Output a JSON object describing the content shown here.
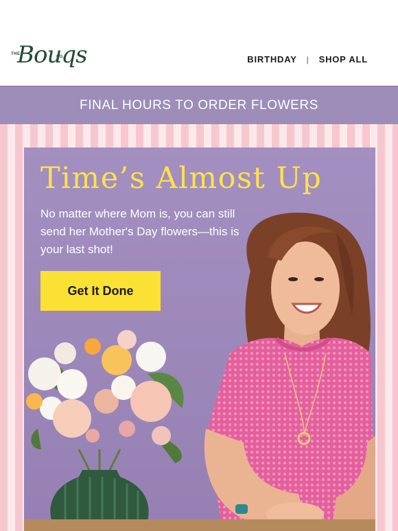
{
  "brand": {
    "logo_the": "THE",
    "logo_script": "Bouqs",
    "logo_co": "CO."
  },
  "nav": {
    "items": [
      {
        "label": "BIRTHDAY"
      },
      {
        "label": "SHOP ALL"
      }
    ],
    "separator": "|"
  },
  "banner": {
    "text": "FINAL HOURS TO ORDER FLOWERS",
    "color": "#9d8db8"
  },
  "hero": {
    "headline": "Time’s Almost Up",
    "body": "No matter where Mom is, you can still send her Mother's Day flowers—this is your last shot!",
    "cta_label": "Get It Done",
    "headline_color": "#fce24a",
    "cta_color": "#fbe134",
    "background_color": "#9c87b9"
  },
  "icons": {
    "logo": "bouqs-logo",
    "bouquet": "flower-bouquet-image",
    "person": "smiling-woman-image"
  }
}
